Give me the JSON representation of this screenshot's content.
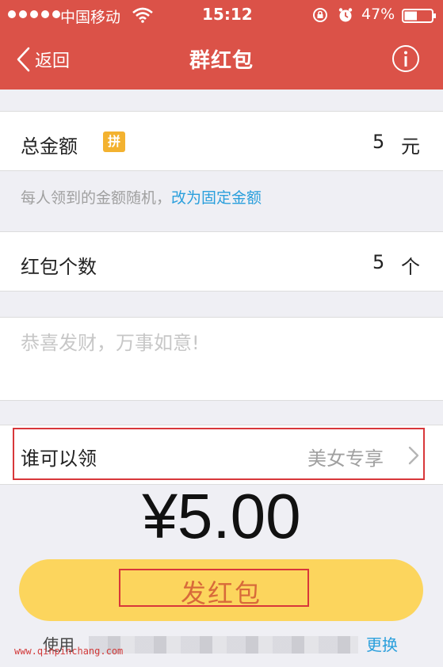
{
  "status_bar": {
    "carrier": "中国移动",
    "time": "15:12",
    "battery_percent": "47%",
    "battery_level": 0.47,
    "icons": [
      "signal-dots",
      "wifi-icon",
      "orientation-lock-icon",
      "alarm-icon",
      "battery-icon"
    ]
  },
  "nav": {
    "back_label": "返回",
    "title": "群红包",
    "info_icon": "info-icon"
  },
  "form": {
    "amount": {
      "label": "总金额",
      "badge": "拼",
      "value": "5",
      "unit": "元"
    },
    "hint": {
      "text": "每人领到的金额随机，",
      "link": "改为固定金额"
    },
    "count": {
      "label": "红包个数",
      "value": "5",
      "unit": "个"
    },
    "greeting": {
      "placeholder": "恭喜发财，万事如意!"
    },
    "who_can_claim": {
      "label": "谁可以领",
      "value": "美女专享"
    }
  },
  "total_display": "¥5.00",
  "send_button": {
    "label": "发红包"
  },
  "footer": {
    "prefix": "使用",
    "link": "更换"
  },
  "watermark": "www.qinpinchang.com",
  "colors": {
    "header": "#db5248",
    "badge": "#f3b230",
    "link": "#2a9fdc",
    "send_button": "#fcd55d",
    "highlight_box": "#d8373a"
  }
}
